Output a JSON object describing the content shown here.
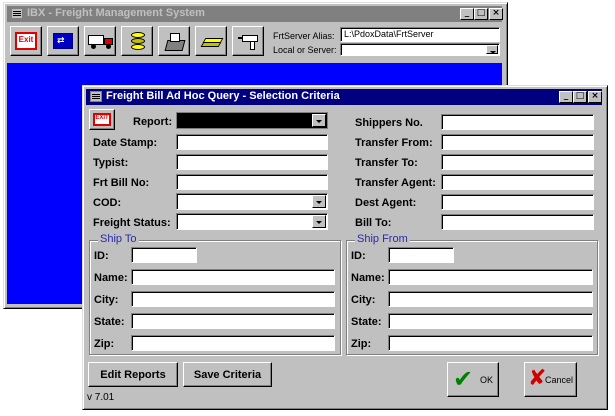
{
  "main_window": {
    "title": "IBX - Freight Management System",
    "toolbar": {
      "exit_icon_text": "Exit",
      "alias_label": "FrtServer Alias:",
      "alias_value": "L:\\PdoxData\\FrtServer",
      "local_server_label": "Local or Server:",
      "local_server_value": ""
    }
  },
  "dialog": {
    "title": "Freight Bill Ad Hoc Query - Selection Criteria",
    "exit_icon_text": "EXIT",
    "left_fields": {
      "report": {
        "label": "Report:",
        "value": ""
      },
      "date_stamp": {
        "label": "Date Stamp:",
        "value": ""
      },
      "typist": {
        "label": "Typist:",
        "value": ""
      },
      "frt_bill_no": {
        "label": "Frt Bill No:",
        "value": ""
      },
      "cod": {
        "label": "COD:",
        "value": ""
      },
      "freight_status": {
        "label": "Freight Status:",
        "value": ""
      }
    },
    "right_fields": {
      "shippers_no": {
        "label": "Shippers No.",
        "value": ""
      },
      "transfer_from": {
        "label": "Transfer From:",
        "value": ""
      },
      "transfer_to": {
        "label": "Transfer To:",
        "value": ""
      },
      "transfer_agent": {
        "label": "Transfer Agent:",
        "value": ""
      },
      "dest_agent": {
        "label": "Dest Agent:",
        "value": ""
      },
      "bill_to": {
        "label": "Bill To:",
        "value": ""
      }
    },
    "ship_to": {
      "title": "Ship To",
      "id": "ID:",
      "name": "Name:",
      "city": "City:",
      "state": "State:",
      "zip": "Zip:"
    },
    "ship_from": {
      "title": "Ship From",
      "id": "ID:",
      "name": "Name:",
      "city": "City:",
      "state": "State:",
      "zip": "Zip:"
    },
    "buttons": {
      "edit_reports": "Edit Reports",
      "save_criteria": "Save Criteria",
      "ok": "OK",
      "cancel": "Cancel"
    },
    "version": "v 7.01"
  },
  "colors": {
    "active_title": "#000080",
    "inactive_title": "#808080",
    "desktop_blue": "#0000ff",
    "face": "#c0c0c0",
    "group_title": "#2a2aa8"
  }
}
